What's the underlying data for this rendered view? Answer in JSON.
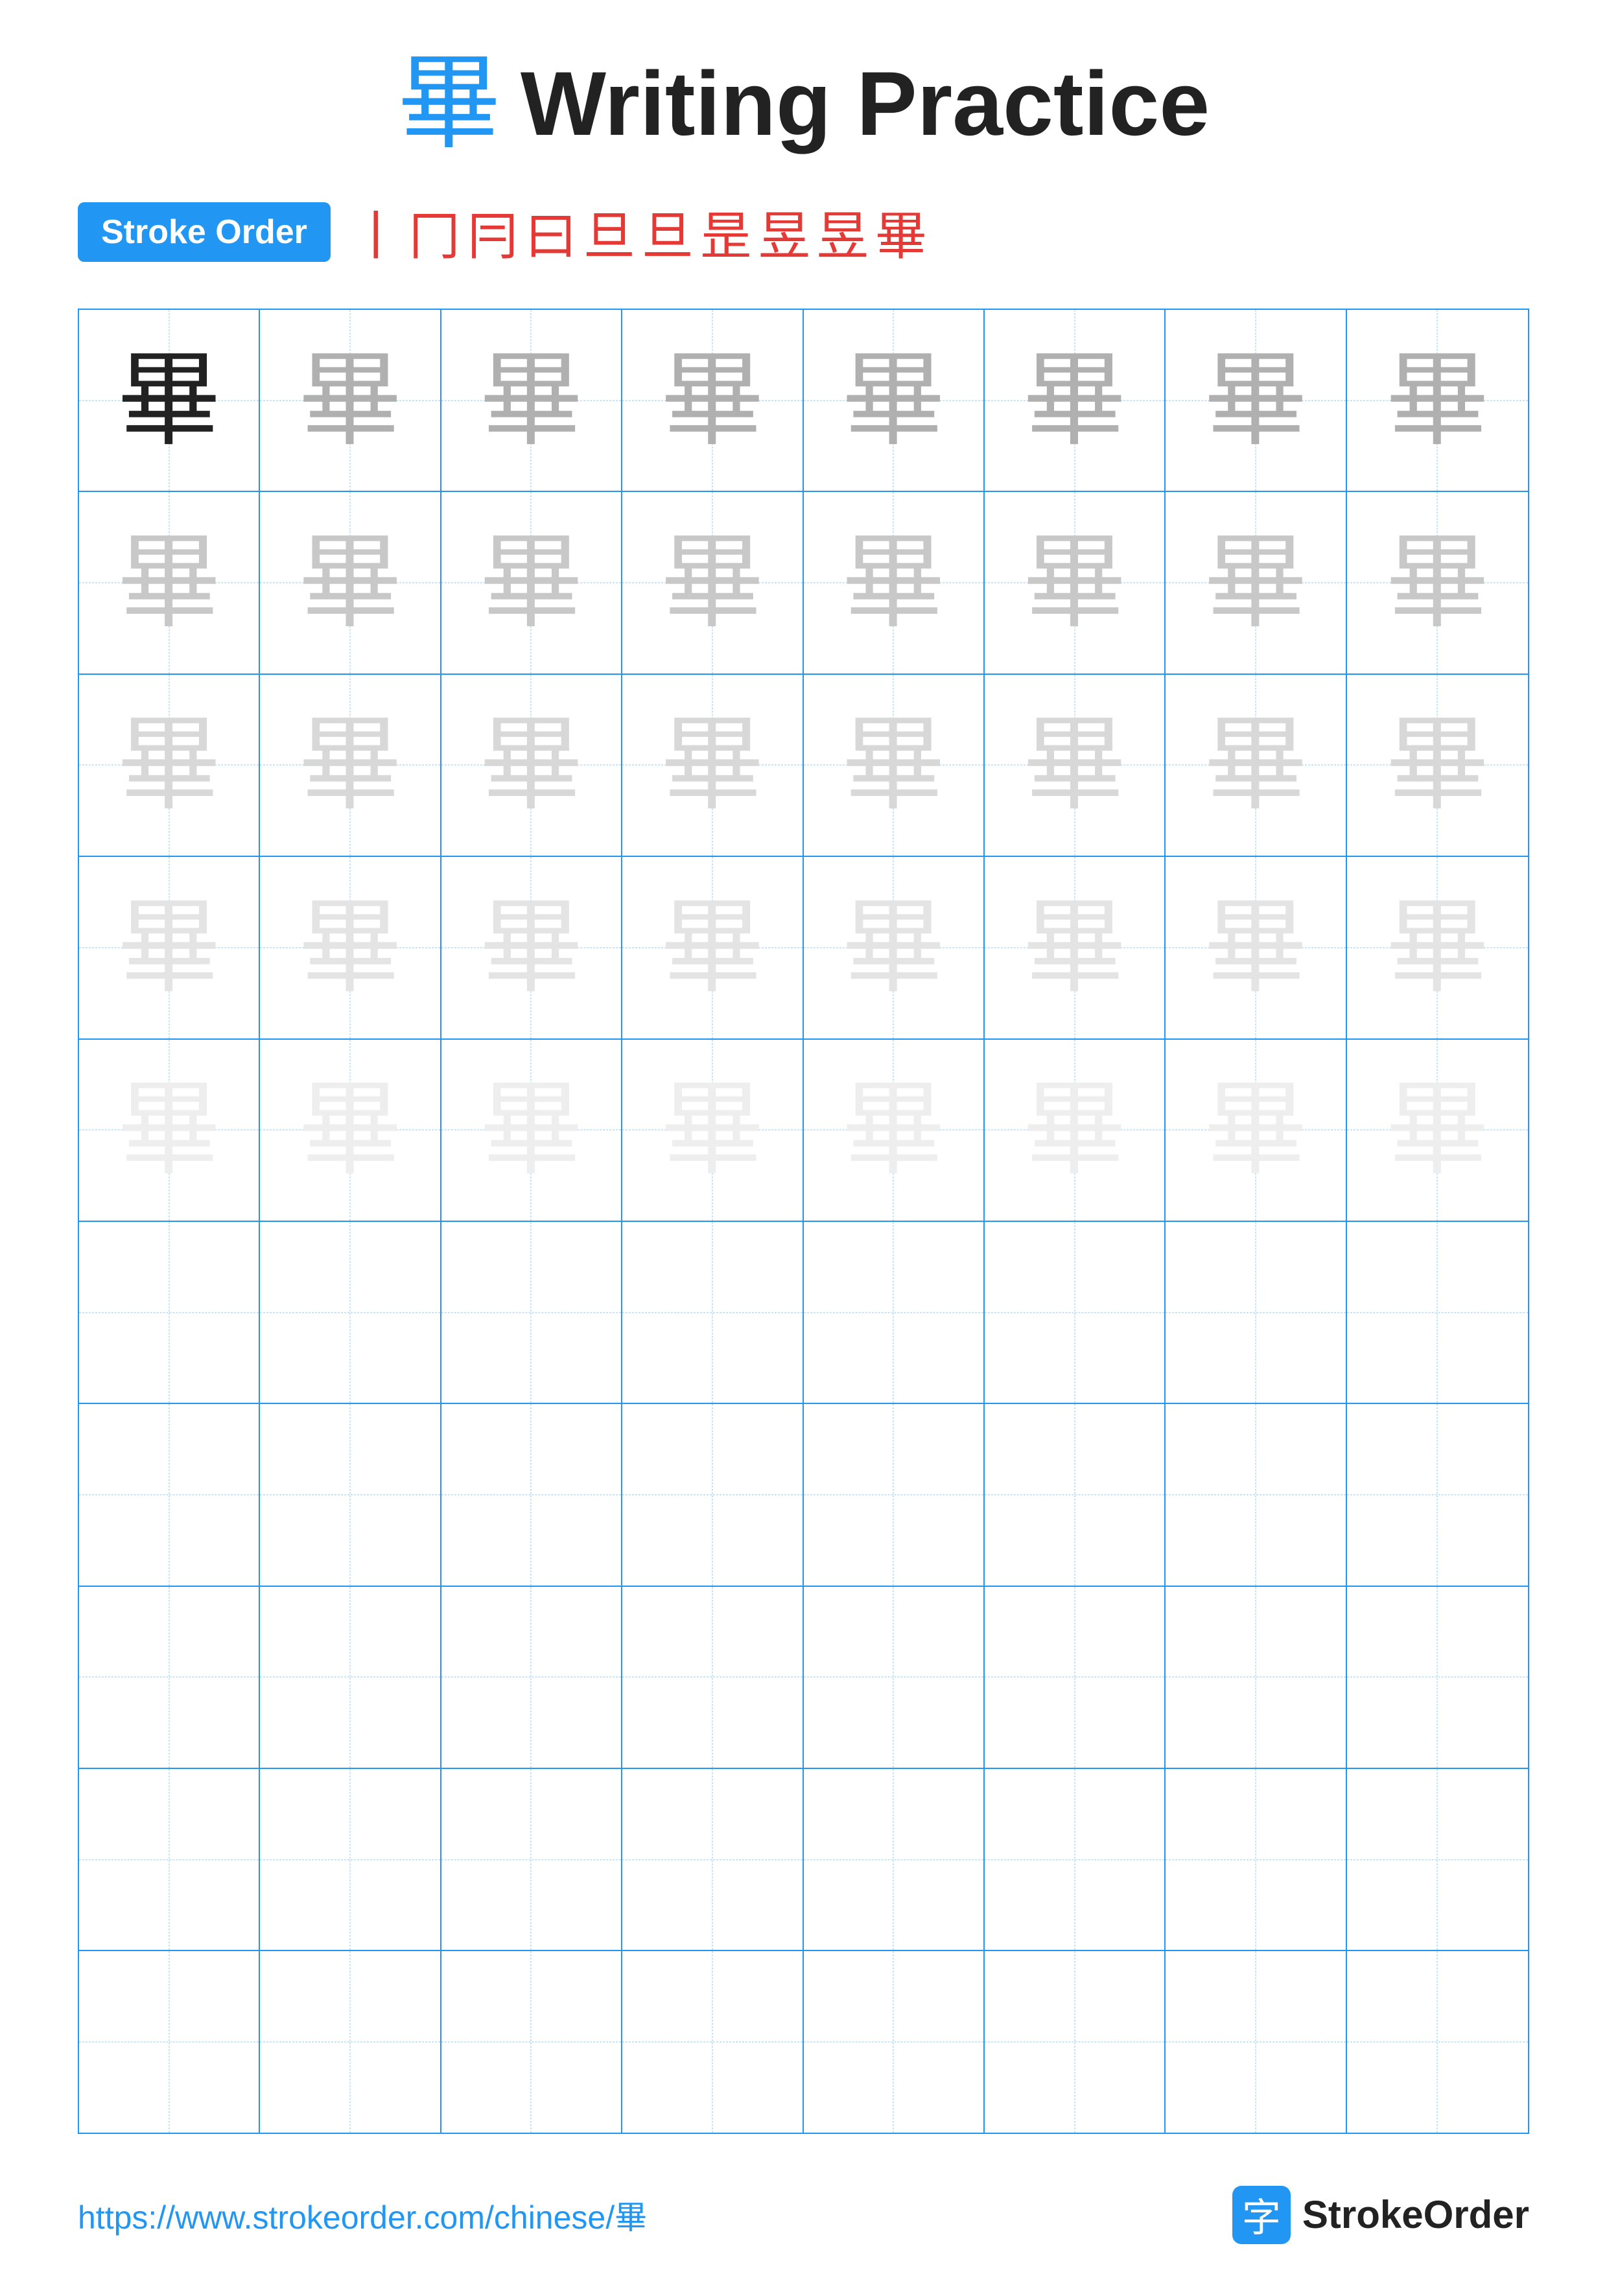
{
  "title": {
    "char": "畢",
    "text": "Writing Practice"
  },
  "stroke_order": {
    "badge_label": "Stroke Order",
    "chars": [
      "丨",
      "冂",
      "冃",
      "曰",
      "旦",
      "旦",
      "昰",
      "昱",
      "昱",
      "畢"
    ]
  },
  "grid": {
    "rows": 10,
    "cols": 8,
    "char": "畢",
    "practice_char": "畢",
    "filled_rows": 5,
    "empty_rows": 5
  },
  "footer": {
    "url": "https://www.strokeorder.com/chinese/畢",
    "brand_char": "字",
    "brand_name": "StrokeOrder"
  }
}
